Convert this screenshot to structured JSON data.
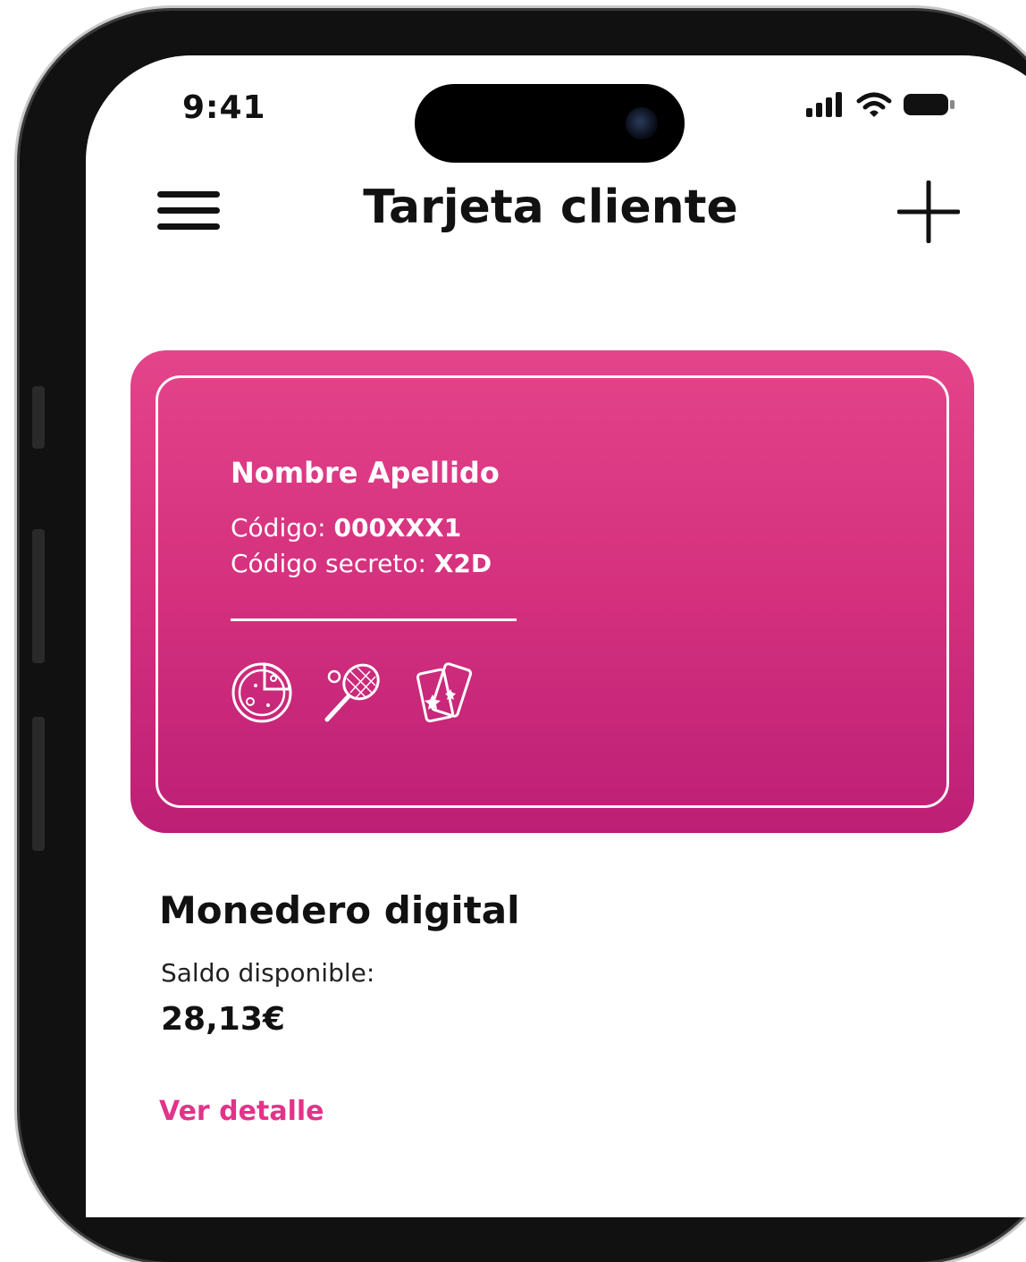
{
  "status_bar": {
    "time": "9:41"
  },
  "header": {
    "title": "Tarjeta cliente",
    "menu_icon": "hamburger-menu-icon",
    "add_icon": "plus-icon"
  },
  "card": {
    "name": "Nombre Apellido",
    "code_label": "Código:",
    "code_value": "000XXX1",
    "secret_label": "Código secreto:",
    "secret_value": "X2D",
    "icons": [
      "pizza-icon",
      "tennis-racket-icon",
      "tickets-icon"
    ],
    "gradient_top": "#e4448a",
    "gradient_bottom": "#bd1f76"
  },
  "wallet": {
    "title": "Monedero digital",
    "balance_label": "Saldo disponible:",
    "balance_value": "28,13€",
    "detail_link": "Ver detalle",
    "link_color": "#e2338a"
  }
}
